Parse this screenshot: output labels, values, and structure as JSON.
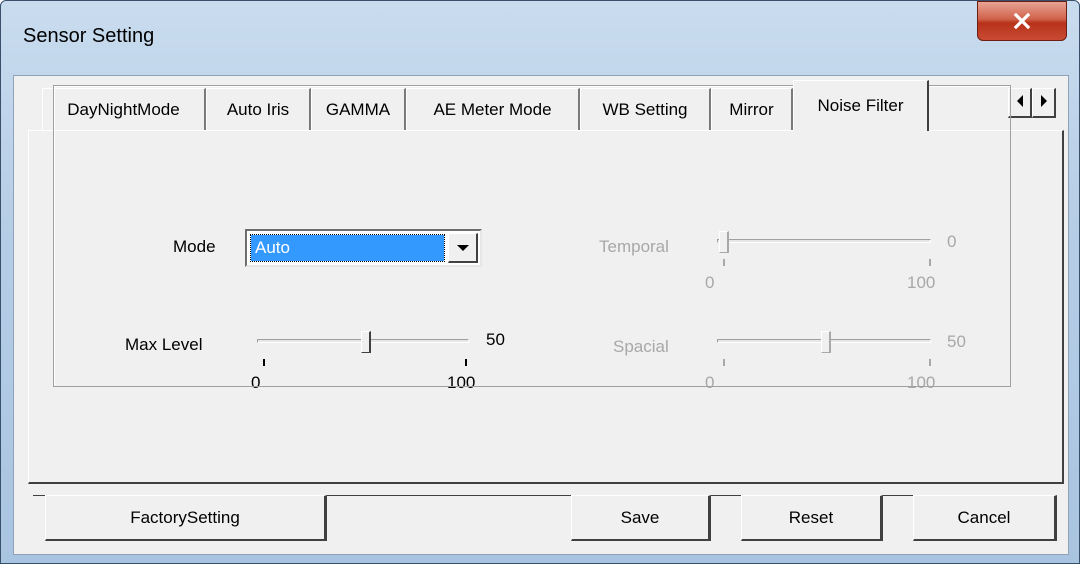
{
  "window": {
    "title": "Sensor Setting"
  },
  "tabs": [
    {
      "label": "DayNightMode"
    },
    {
      "label": "Auto Iris"
    },
    {
      "label": "GAMMA"
    },
    {
      "label": "AE Meter Mode"
    },
    {
      "label": "WB Setting"
    },
    {
      "label": "Mirror"
    },
    {
      "label": "Noise Filter",
      "active": true
    }
  ],
  "noise_filter": {
    "mode_label": "Mode",
    "mode_value": "Auto",
    "max_level": {
      "label": "Max Level",
      "value": "50",
      "min": "0",
      "max": "100"
    },
    "temporal": {
      "label": "Temporal",
      "value": "0",
      "min": "0",
      "max": "100",
      "enabled": false
    },
    "spacial": {
      "label": "Spacial",
      "value": "50",
      "min": "0",
      "max": "100",
      "enabled": false
    }
  },
  "buttons": {
    "factory": "FactorySetting",
    "save": "Save",
    "reset": "Reset",
    "cancel": "Cancel"
  },
  "icons": {
    "close": "close-icon",
    "tab_left": "triangle-left-icon",
    "tab_right": "triangle-right-icon",
    "dropdown": "triangle-down-icon"
  },
  "colors": {
    "selection": "#3399ff",
    "close_button": "#c84b33",
    "disabled_text": "#a8a8a8"
  }
}
